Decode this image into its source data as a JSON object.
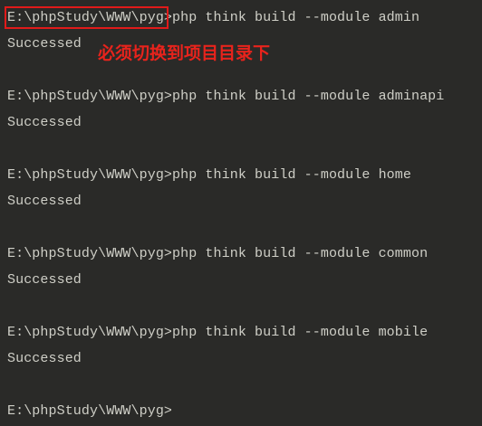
{
  "terminal": {
    "prompt": "E:\\phpStudy\\WWW\\pyg>",
    "lines": [
      {
        "prompt": "E:\\phpStudy\\WWW\\pyg>",
        "command": "php think build --module admin"
      },
      {
        "output": "Successed"
      },
      {
        "prompt": "E:\\phpStudy\\WWW\\pyg>",
        "command": "php think build --module adminapi"
      },
      {
        "output": "Successed"
      },
      {
        "prompt": "E:\\phpStudy\\WWW\\pyg>",
        "command": "php think build --module home"
      },
      {
        "output": "Successed"
      },
      {
        "prompt": "E:\\phpStudy\\WWW\\pyg>",
        "command": "php think build --module common"
      },
      {
        "output": "Successed"
      },
      {
        "prompt": "E:\\phpStudy\\WWW\\pyg>",
        "command": "php think build --module mobile"
      },
      {
        "output": "Successed"
      },
      {
        "prompt": "E:\\phpStudy\\WWW\\pyg>",
        "command": ""
      }
    ]
  },
  "annotation": {
    "text": "必须切换到项目目录下",
    "color": "#e8231c"
  },
  "colors": {
    "background": "#2a2a28",
    "text": "#cfcfc7",
    "highlight_border": "#e01a1a"
  }
}
